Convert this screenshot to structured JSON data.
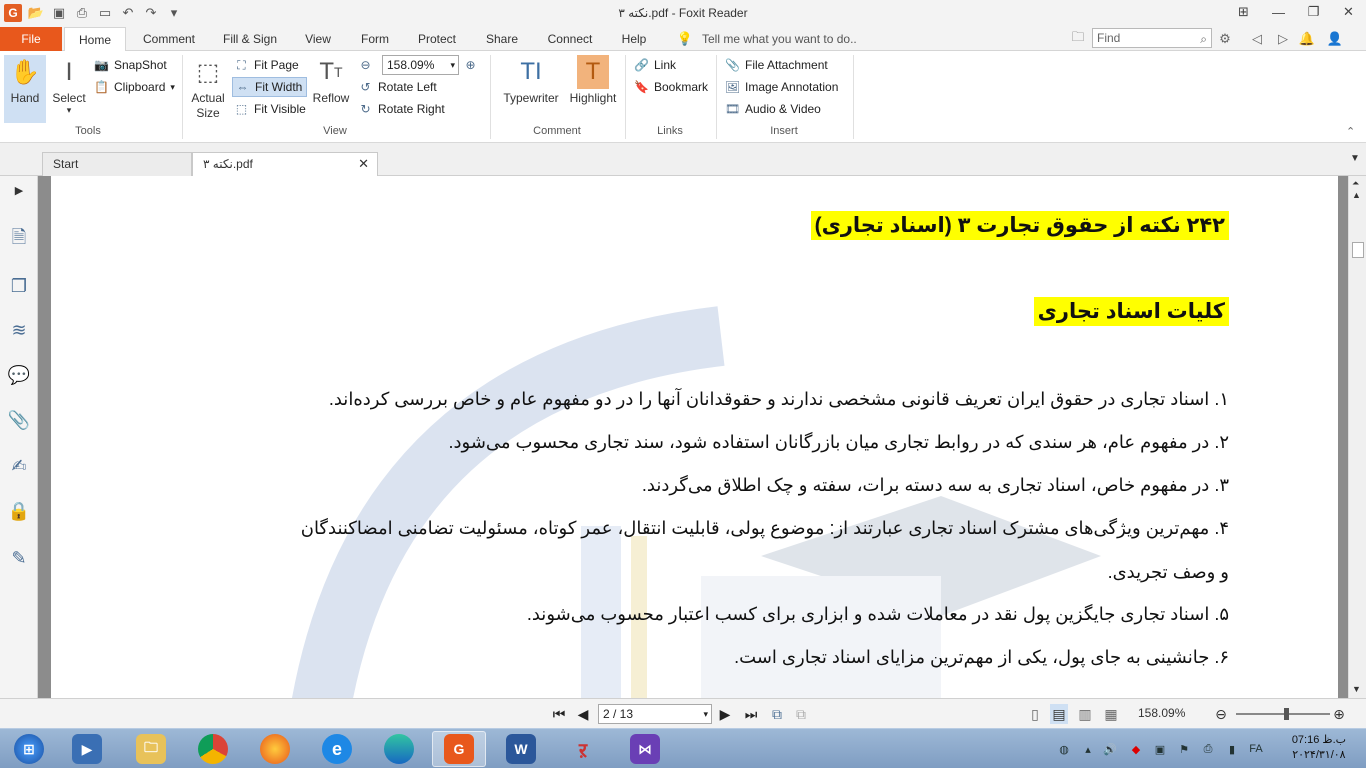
{
  "window": {
    "title": "نکته ۳.pdf - Foxit Reader"
  },
  "ribbon_tabs": [
    "File",
    "Home",
    "Comment",
    "Fill & Sign",
    "View",
    "Form",
    "Protect",
    "Share",
    "Connect",
    "Help"
  ],
  "tell_me": "Tell me what you want to do..",
  "find_placeholder": "Find",
  "ribbon": {
    "hand": "Hand",
    "select": "Select",
    "snapshot": "SnapShot",
    "clipboard": "Clipboard",
    "tools_label": "Tools",
    "actual_size": "Actual Size",
    "fit_page": "Fit Page",
    "fit_width": "Fit Width",
    "fit_visible": "Fit Visible",
    "reflow": "Reflow",
    "zoom_value": "158.09%",
    "rotate_left": "Rotate Left",
    "rotate_right": "Rotate Right",
    "view_label": "View",
    "typewriter": "Typewriter",
    "highlight": "Highlight",
    "comment_label": "Comment",
    "link": "Link",
    "bookmark": "Bookmark",
    "links_label": "Links",
    "file_attachment": "File Attachment",
    "image_annotation": "Image Annotation",
    "audio_video": "Audio & Video",
    "insert_label": "Insert"
  },
  "doc_tabs": {
    "start": "Start",
    "current": "نکته ۳.pdf"
  },
  "document": {
    "heading1": "۲۴۲ نکته از حقوق تجارت ۳ (اسناد تجاری)",
    "heading2": "کلیات اسناد تجاری",
    "lines": [
      "۱. اسناد تجاری در حقوق ایران تعریف قانونی مشخصی ندارند و حقوقدانان آنها را در دو مفهوم عام و خاص بررسی کرده‌اند.",
      "۲. در مفهوم عام، هر سندی که در روابط تجاری میان بازرگانان استفاده شود، سند تجاری محسوب می‌شود.",
      "۳. در مفهوم خاص، اسناد تجاری به سه دسته برات، سفته و چک اطلاق می‌گردند.",
      "۴. مهم‌ترین ویژگی‌های مشترک اسناد تجاری عبارتند از: موضوع پولی، قابلیت انتقال، عمر کوتاه، مسئولیت تضامنی امضاکنندگان",
      "و وصف تجریدی.",
      "۵. اسناد تجاری جایگزین پول نقد در معاملات شده و ابزاری برای کسب اعتبار محسوب می‌شوند.",
      "۶. جانشینی به جای پول، یکی از مهم‌ترین مزایای اسناد تجاری است."
    ]
  },
  "status": {
    "page_value": "2 / 13",
    "zoom": "158.09%"
  },
  "taskbar": {
    "time": "07:16 ب.ظ",
    "date": "۲۰۲۴/۳۱/۰۸"
  },
  "colors": {
    "file_tab": "#e8581c",
    "highlight": "#ffff00",
    "hand_active": "#cfe0f3"
  }
}
